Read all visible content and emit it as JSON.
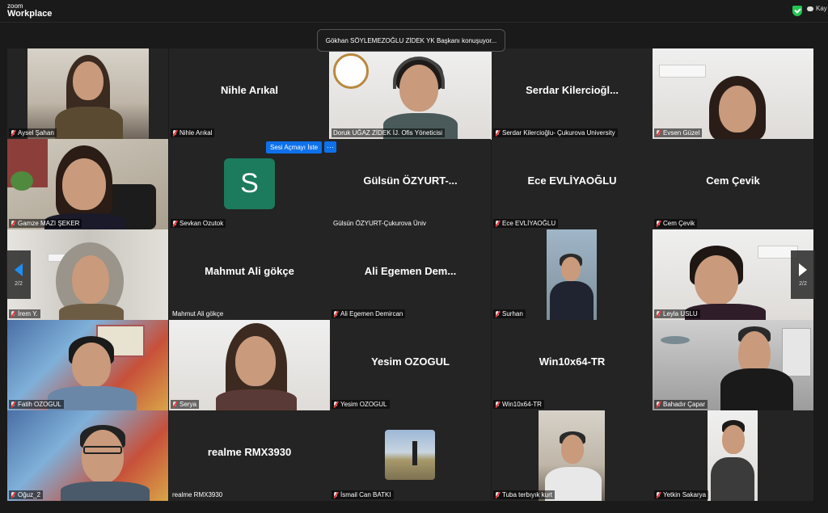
{
  "app": {
    "brand_small": "zoom",
    "brand_name": "Workplace",
    "recording_label": "Kay"
  },
  "active_speaker": "Gökhan SÖYLEMEZOĞLU ZİDEK YK Başkanı konuşuyor...",
  "hover_actions": {
    "unmute": "Sesi Açmayı İste",
    "more": "···"
  },
  "pager": {
    "page": "2/2"
  },
  "participants": [
    {
      "label": "Aysel Şahan",
      "display": "",
      "video": true
    },
    {
      "label": "Nihle Arıkal",
      "display": "Nihle Arıkal",
      "video": false
    },
    {
      "label": "Doruk UĞAZ ZİDEK İJ. Ofis Yöneticisi",
      "display": "",
      "video": true
    },
    {
      "label": "Serdar Kilercioğlu- Çukurova University",
      "display": "Serdar  Kilercioğl...",
      "video": false
    },
    {
      "label": "Evsen Güzel",
      "display": "",
      "video": true
    },
    {
      "label": "Gamze MAZI ŞEKER",
      "display": "",
      "video": true
    },
    {
      "label": "Sevkan Ozutok",
      "display": "",
      "avatar": "S",
      "video": false
    },
    {
      "label": "Gülsün ÖZYURT-Çukurova Üniv",
      "display": "Gülsün  ÖZYURT-...",
      "video": false
    },
    {
      "label": "Ece EVLİYAOĞLU",
      "display": "Ece EVLİYAOĞLU",
      "video": false
    },
    {
      "label": "Cem Çevik",
      "display": "Cem Çevik",
      "video": false
    },
    {
      "label": "İrem Y.",
      "display": "",
      "video": true
    },
    {
      "label": "Mahmut Ali gökçe",
      "display": "Mahmut Ali gökçe",
      "video": false
    },
    {
      "label": "Ali Egemen Demircan",
      "display": "Ali  Egemen  Dem...",
      "video": false
    },
    {
      "label": "Surhan",
      "display": "",
      "video": true
    },
    {
      "label": "Leyla USLU",
      "display": "",
      "video": true
    },
    {
      "label": "Fatih OZOGUL",
      "display": "",
      "video": true
    },
    {
      "label": "Serya",
      "display": "",
      "video": true
    },
    {
      "label": "Yesim OZOGUL",
      "display": "Yesim OZOGUL",
      "video": false
    },
    {
      "label": "Win10x64-TR",
      "display": "Win10x64-TR",
      "video": false
    },
    {
      "label": "Bahadır Çapar",
      "display": "",
      "video": true
    },
    {
      "label": "Oğuz_2",
      "display": "",
      "video": true
    },
    {
      "label": "realme RMX3930",
      "display": "realme RMX3930",
      "video": false
    },
    {
      "label": "İsmail Can BATKI",
      "display": "",
      "video": true
    },
    {
      "label": "Tuba terbıyık kurt",
      "display": "",
      "video": true
    },
    {
      "label": "Yetkin Sakarya",
      "display": "",
      "video": true
    }
  ],
  "colors": {
    "accent": "#0e71eb",
    "secure": "#23c552",
    "tile_bg": "#242424",
    "muted_red": "#e5393a"
  }
}
